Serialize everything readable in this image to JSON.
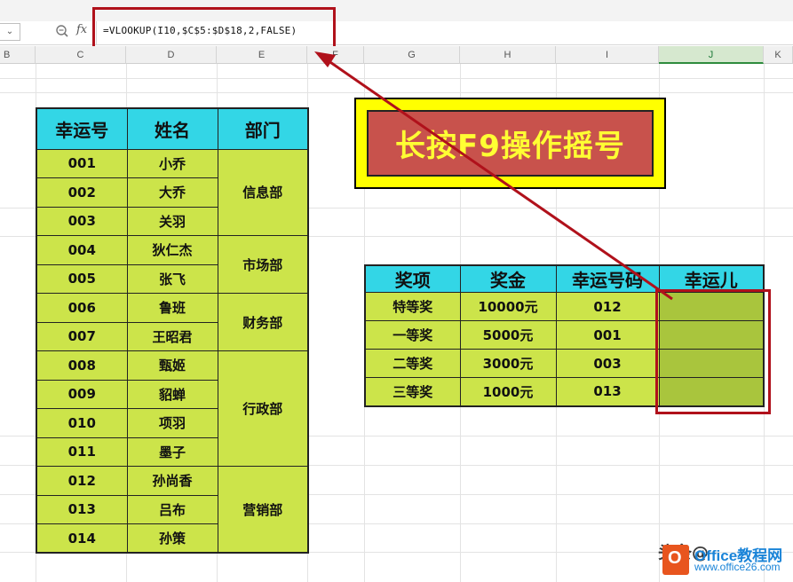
{
  "toolbar": {
    "namebox_arrow": "⌄",
    "fx_label": "fx",
    "formula": "=VLOOKUP(I10,$C$5:$D$18,2,FALSE)"
  },
  "columns": [
    "B",
    "C",
    "D",
    "E",
    "F",
    "G",
    "H",
    "I",
    "J",
    "K"
  ],
  "active_column": "J",
  "left_table": {
    "headers": [
      "幸运号",
      "姓名",
      "部门"
    ],
    "rows": [
      {
        "num": "001",
        "name": "小乔"
      },
      {
        "num": "002",
        "name": "大乔"
      },
      {
        "num": "003",
        "name": "关羽"
      },
      {
        "num": "004",
        "name": "狄仁杰"
      },
      {
        "num": "005",
        "name": "张飞"
      },
      {
        "num": "006",
        "name": "鲁班"
      },
      {
        "num": "007",
        "name": "王昭君"
      },
      {
        "num": "008",
        "name": "甄姬"
      },
      {
        "num": "009",
        "name": "貂蝉"
      },
      {
        "num": "010",
        "name": "项羽"
      },
      {
        "num": "011",
        "name": "墨子"
      },
      {
        "num": "012",
        "name": "孙尚香"
      },
      {
        "num": "013",
        "name": "吕布"
      },
      {
        "num": "014",
        "name": "孙策"
      }
    ],
    "departments": [
      {
        "label": "信息部",
        "rows": 3
      },
      {
        "label": "市场部",
        "rows": 2
      },
      {
        "label": "财务部",
        "rows": 2
      },
      {
        "label": "行政部",
        "rows": 4
      },
      {
        "label": "营销部",
        "rows": 3
      }
    ]
  },
  "banner": {
    "text": "长按F9操作摇号"
  },
  "right_table": {
    "headers": [
      "奖项",
      "奖金",
      "幸运号码",
      "幸运儿"
    ],
    "rows": [
      {
        "prize": "特等奖",
        "amount": "10000元",
        "code": "012",
        "winner": ""
      },
      {
        "prize": "一等奖",
        "amount": "5000元",
        "code": "001",
        "winner": ""
      },
      {
        "prize": "二等奖",
        "amount": "3000元",
        "code": "003",
        "winner": ""
      },
      {
        "prize": "三等奖",
        "amount": "1000元",
        "code": "013",
        "winner": ""
      }
    ]
  },
  "watermark": {
    "site": "Office教程网",
    "url": "www.office26.com",
    "prefix": "头条@"
  },
  "colors": {
    "header_cyan": "#33d6e6",
    "cell_lime": "#cce44a",
    "highlight_red": "#b0111b",
    "banner_yellow": "#ffff00",
    "banner_red": "#c8524c"
  }
}
